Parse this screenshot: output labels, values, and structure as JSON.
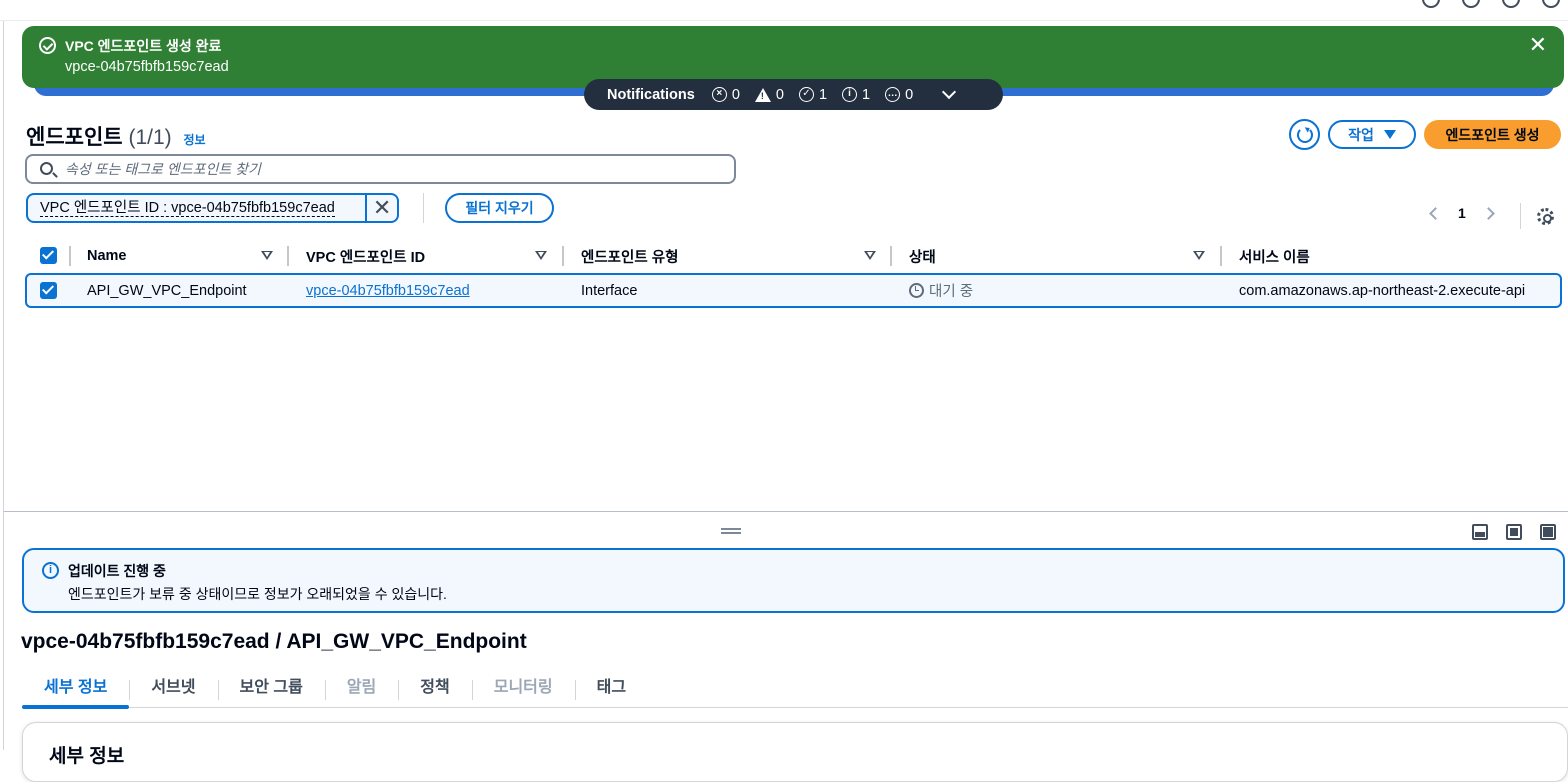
{
  "flash": {
    "title": "VPC 엔드포인트 생성 완료",
    "subtitle": "vpce-04b75fbfb159c7ead",
    "close_glyph": "✕",
    "color": "#2f7f34"
  },
  "notifications": {
    "title": "Notifications",
    "error_count": "0",
    "warning_count": "0",
    "success_count": "1",
    "info_count": "1",
    "progress_count": "0"
  },
  "header": {
    "title": "엔드포인트",
    "count": "(1/1)",
    "info_link": "정보",
    "actions_label": "작업",
    "create_label": "엔드포인트 생성"
  },
  "search": {
    "placeholder": "속성 또는 태그로 엔드포인트 찾기"
  },
  "filter": {
    "token": "VPC 엔드포인트 ID : vpce-04b75fbfb159c7ead",
    "remove_glyph": "✕",
    "clear_label": "필터 지우기"
  },
  "pagination": {
    "current_page": "1"
  },
  "table": {
    "columns": [
      "Name",
      "VPC 엔드포인트 ID",
      "엔드포인트 유형",
      "상태",
      "서비스 이름"
    ],
    "rows": [
      {
        "name": "API_GW_VPC_Endpoint",
        "endpoint_id": "vpce-04b75fbfb159c7ead",
        "type": "Interface",
        "status": "대기 중",
        "service_name": "com.amazonaws.ap-northeast-2.execute-api",
        "selected": true
      }
    ]
  },
  "split_panel": {
    "alert_title": "업데이트 진행 중",
    "alert_body": "엔드포인트가 보류 중 상태이므로 정보가 오래되었을 수 있습니다.",
    "detail_title": "vpce-04b75fbfb159c7ead / API_GW_VPC_Endpoint",
    "tabs": [
      {
        "label": "세부 정보",
        "state": "active"
      },
      {
        "label": "서브넷",
        "state": "normal"
      },
      {
        "label": "보안 그룹",
        "state": "normal"
      },
      {
        "label": "알림",
        "state": "disabled"
      },
      {
        "label": "정책",
        "state": "normal"
      },
      {
        "label": "모니터링",
        "state": "disabled"
      },
      {
        "label": "태그",
        "state": "normal"
      }
    ],
    "card_title": "세부 정보"
  },
  "colors": {
    "primary": "#0972d3",
    "create_button": "#f89d2e",
    "notification_bar": "#232f3e"
  }
}
